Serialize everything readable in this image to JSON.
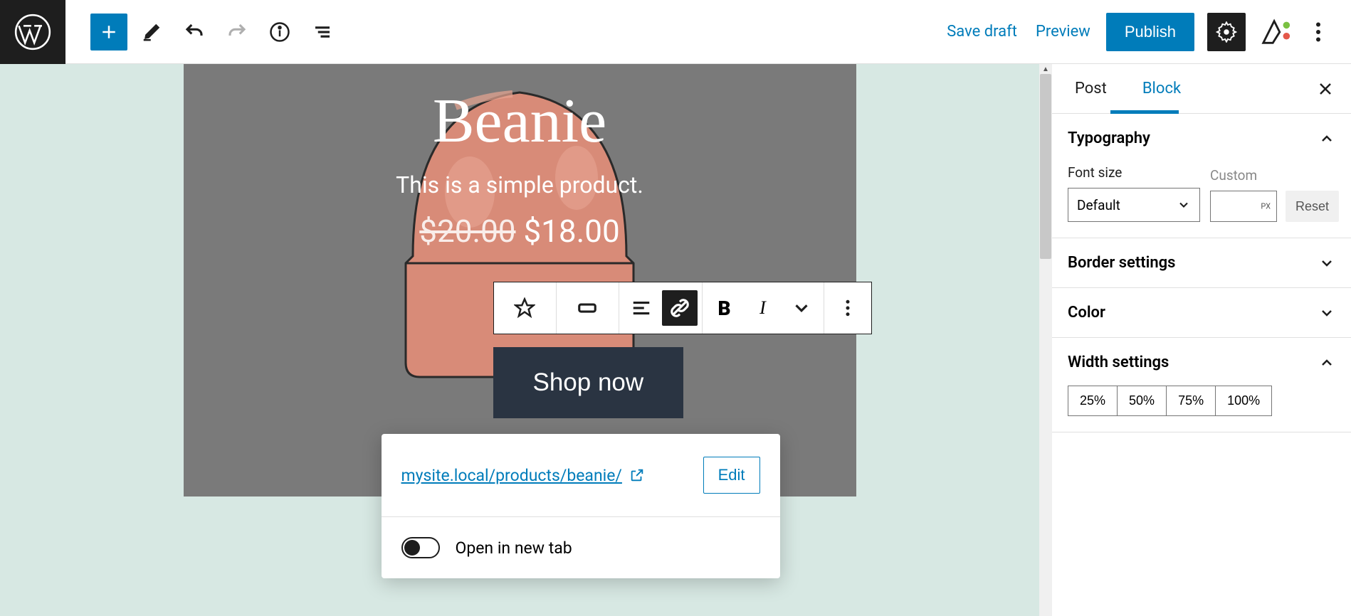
{
  "toolbar": {
    "save_draft": "Save draft",
    "preview": "Preview",
    "publish": "Publish"
  },
  "product": {
    "title": "Beanie",
    "description": "This is a simple product.",
    "price_old": "$20.00",
    "price_new": "$18.00",
    "button": "Shop now"
  },
  "link_popover": {
    "url": "mysite.local/products/beanie/",
    "edit": "Edit",
    "new_tab": "Open in new tab"
  },
  "sidebar": {
    "tabs": {
      "post": "Post",
      "block": "Block"
    },
    "typography": {
      "title": "Typography",
      "font_size": "Font size",
      "custom": "Custom",
      "select_value": "Default",
      "unit": "PX",
      "reset": "Reset"
    },
    "border": {
      "title": "Border settings"
    },
    "color": {
      "title": "Color"
    },
    "width": {
      "title": "Width settings",
      "options": [
        "25%",
        "50%",
        "75%",
        "100%"
      ]
    }
  }
}
